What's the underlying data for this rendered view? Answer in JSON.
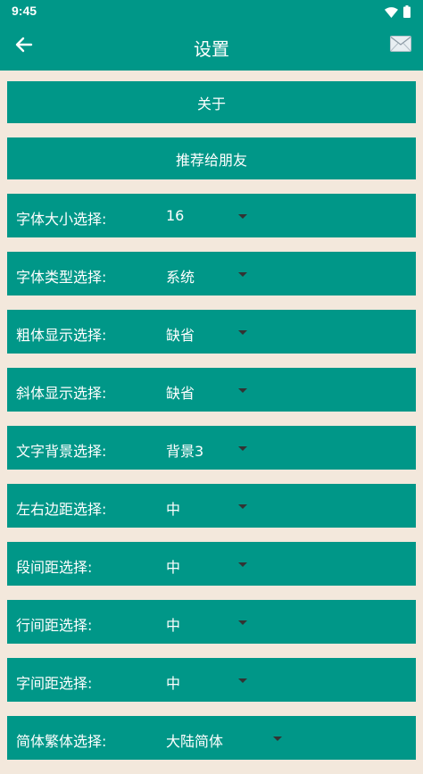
{
  "status_bar": {
    "time": "9:45"
  },
  "app_bar": {
    "title": "设置",
    "back_icon": "arrow-left-icon",
    "mail_icon": "envelope-icon"
  },
  "buttons": {
    "about": "关于",
    "recommend": "推荐给朋友"
  },
  "settings": [
    {
      "label": "字体大小选择:",
      "value": "16"
    },
    {
      "label": "字体类型选择:",
      "value": "系统"
    },
    {
      "label": "粗体显示选择:",
      "value": "缺省"
    },
    {
      "label": "斜体显示选择:",
      "value": "缺省"
    },
    {
      "label": "文字背景选择:",
      "value": "背景3"
    },
    {
      "label": "左右边距选择:",
      "value": "中"
    },
    {
      "label": "段间距选择:",
      "value": "中"
    },
    {
      "label": "行间距选择:",
      "value": "中"
    },
    {
      "label": "字间距选择:",
      "value": "中"
    },
    {
      "label": "简体繁体选择:",
      "value": "大陆简体"
    }
  ],
  "colors": {
    "primary": "#009788",
    "background": "#f3e8dc",
    "text": "#ffffff",
    "caret": "#333333"
  }
}
